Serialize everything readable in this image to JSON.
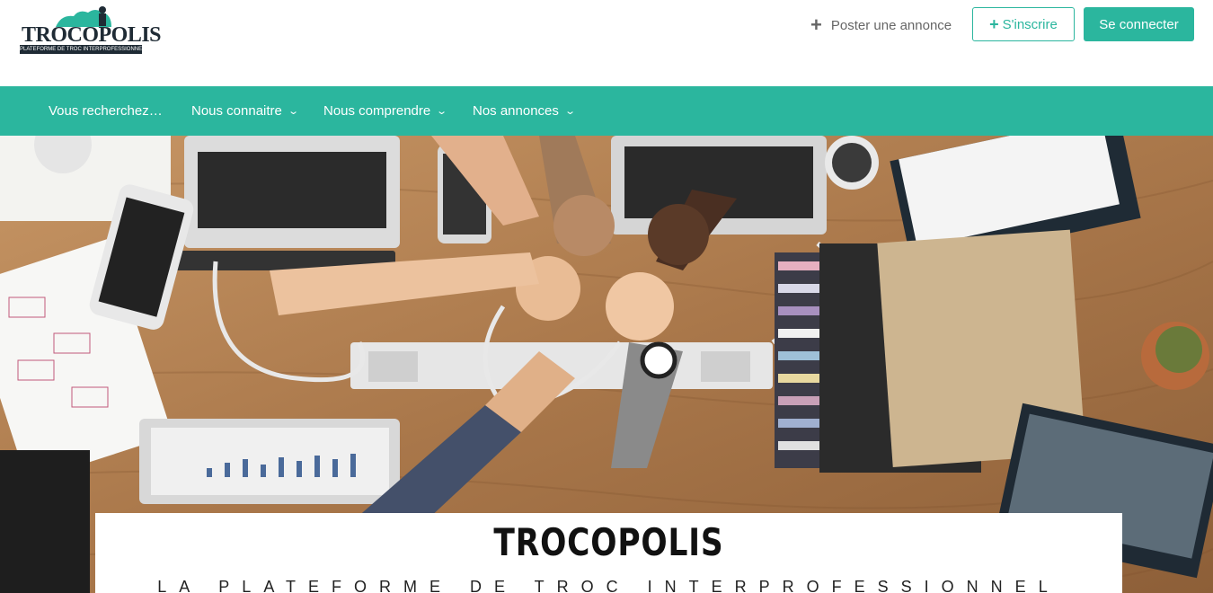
{
  "brand": {
    "logo_title": "TROCOPOLIS",
    "logo_subtitle": "PLATEFORME DE TROC INTERPROFESSIONNEL"
  },
  "header": {
    "post_ad_label": "Poster une annonce",
    "signup_label": "S'inscrire",
    "login_label": "Se connecter"
  },
  "nav": {
    "items": [
      {
        "label": "Vous recherchez…"
      },
      {
        "label": "Nous connaitre"
      },
      {
        "label": "Nous comprendre"
      },
      {
        "label": "Nos annonces"
      }
    ]
  },
  "hero": {
    "title": "TROCOPOLIS",
    "subtitle": "LA PLATEFORME DE TROC INTERPROFESSIONNEL"
  },
  "colors": {
    "accent": "#2bb69e",
    "dark": "#1f2b35",
    "wood": "#b8875a"
  }
}
